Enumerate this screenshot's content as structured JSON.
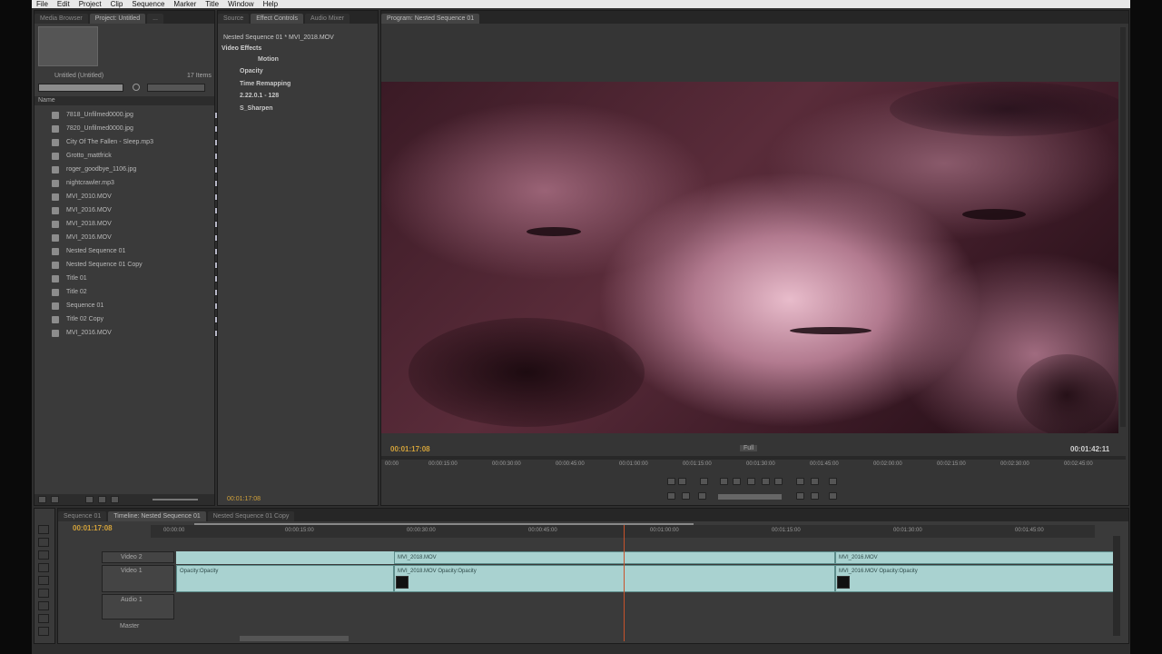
{
  "menu": [
    "File",
    "Edit",
    "Project",
    "Clip",
    "Sequence",
    "Marker",
    "Title",
    "Window",
    "Help"
  ],
  "project_panel": {
    "tabs": [
      "Media Browser",
      "Project: Untitled",
      "..."
    ],
    "item_name": "Untitled (Untitled)",
    "item_count": "17 Items",
    "column_header": "Name",
    "items": [
      {
        "name": "7818_Unfilmed0000.jpg"
      },
      {
        "name": "7820_Unfilmed0000.jpg"
      },
      {
        "name": "City Of The Fallen - Sleep.mp3"
      },
      {
        "name": "Grotto_mattfrick"
      },
      {
        "name": "roger_goodbye_1106.jpg"
      },
      {
        "name": "nightcrawler.mp3"
      },
      {
        "name": "MVI_2010.MOV"
      },
      {
        "name": "MVI_2016.MOV"
      },
      {
        "name": "MVI_2018.MOV"
      },
      {
        "name": "MVI_2016.MOV"
      },
      {
        "name": "Nested Sequence 01"
      },
      {
        "name": "Nested Sequence 01 Copy"
      },
      {
        "name": "Title 01"
      },
      {
        "name": "Title 02"
      },
      {
        "name": "Sequence 01"
      },
      {
        "name": "Title 02 Copy"
      },
      {
        "name": "MVI_2016.MOV"
      }
    ]
  },
  "effect_controls": {
    "tabs": [
      "Source",
      "Effect Controls",
      "Audio Mixer"
    ],
    "header": "Nested Sequence 01 * MVI_2018.MOV",
    "section": "Video Effects",
    "effects": [
      "Motion",
      "Opacity",
      "Time Remapping",
      "2.22.0.1 - 128",
      "S_Sharpen"
    ],
    "footer_timecode": "00:01:17:08"
  },
  "program_monitor": {
    "tab": "Program: Nested Sequence 01",
    "current_time": "00:01:17:08",
    "duration": "00:01:42:11",
    "zoom_label": "Full",
    "ruler": [
      "00:00",
      "00:00:15:00",
      "00:00:30:00",
      "00:00:45:00",
      "00:01:00:00",
      "00:01:15:00",
      "00:01:30:00",
      "00:01:45:00",
      "00:02:00:00",
      "00:02:15:00",
      "00:02:30:00",
      "00:02:45:00"
    ]
  },
  "timeline": {
    "tabs": [
      "Sequence 01",
      "Timeline: Nested Sequence 01",
      "Nested Sequence 01 Copy"
    ],
    "current_time": "00:01:17:08",
    "ruler": [
      "00:00:00",
      "00:00:15:00",
      "00:00:30:00",
      "00:00:45:00",
      "00:01:00:00",
      "00:01:15:00",
      "00:01:30:00",
      "00:01:45:00"
    ],
    "tracks": [
      "Video 2",
      "Video 1",
      "Audio 1",
      "Master"
    ],
    "clips": {
      "v2a": "MVI_2018.MOV",
      "v2b": "MVI_2016.MOV",
      "v1a": "Opacity:Opacity",
      "v1b": "MVI_2018.MOV Opacity:Opacity",
      "v1c": "MVI_2016.MOV Opacity:Opacity"
    }
  }
}
